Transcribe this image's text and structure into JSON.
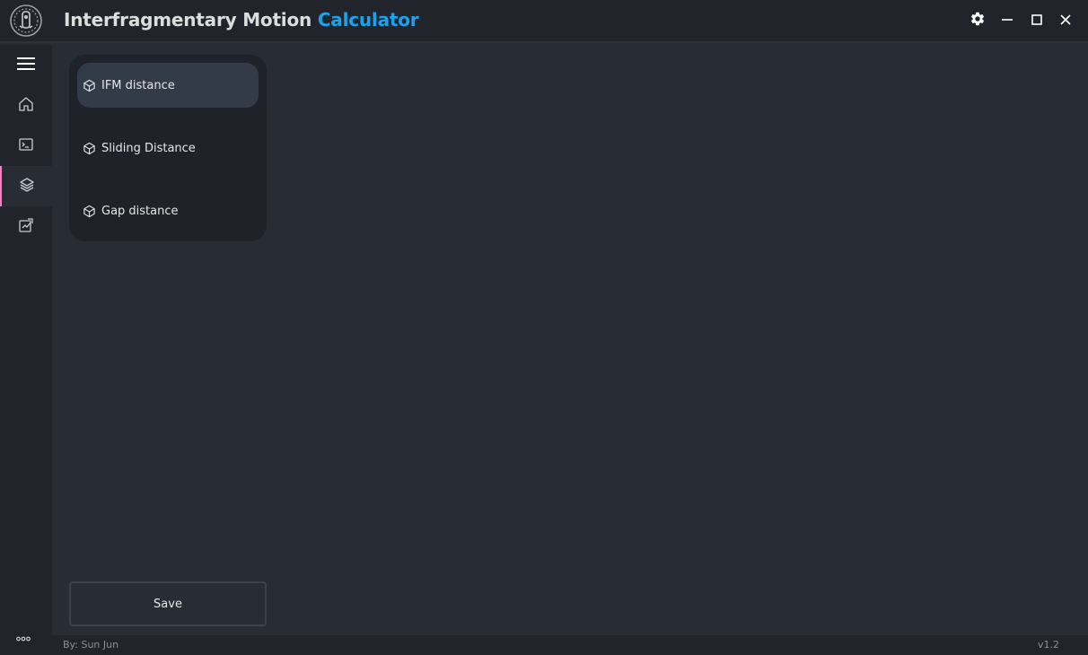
{
  "app": {
    "title_main": "Interfragmentary Motion ",
    "title_accent": "Calculator"
  },
  "colors": {
    "accent": "#1aa3ec",
    "active_indicator": "#ff79c6",
    "background": "#282c34",
    "sidebar": "#21252b"
  },
  "window_controls": {
    "settings_icon": "gear-icon",
    "minimize_icon": "minimize-icon",
    "maximize_icon": "maximize-icon",
    "close_icon": "close-icon"
  },
  "rail": {
    "items": [
      {
        "icon": "hamburger-menu-icon"
      },
      {
        "icon": "home-icon"
      },
      {
        "icon": "terminal-icon"
      },
      {
        "icon": "layers-icon",
        "active": true
      },
      {
        "icon": "chart-export-icon"
      }
    ],
    "more_icon": "more-dots-icon"
  },
  "menu": {
    "items": [
      {
        "label": "IFM distance",
        "icon": "cube-icon",
        "selected": true
      },
      {
        "label": "Sliding Distance",
        "icon": "cube-icon"
      },
      {
        "label": "Gap distance",
        "icon": "cube-icon"
      }
    ]
  },
  "actions": {
    "save_label": "Save"
  },
  "footer": {
    "author": "By: Sun Jun",
    "version": "v1.2"
  }
}
